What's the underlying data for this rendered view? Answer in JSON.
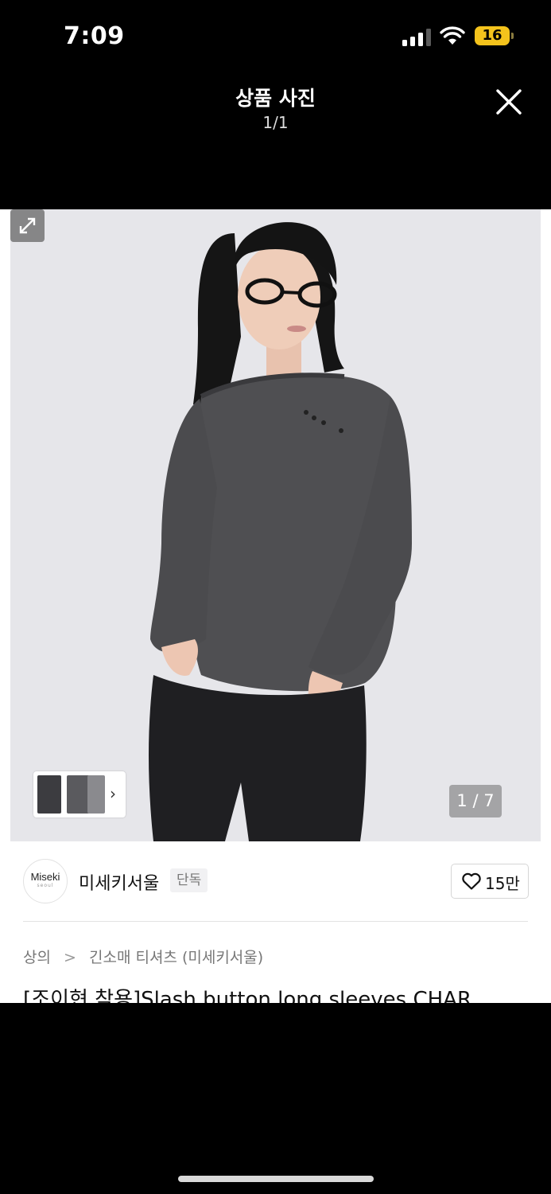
{
  "status_bar": {
    "time": "7:09",
    "battery_level": "16",
    "icons": [
      "cellular-signal-icon",
      "wifi-icon",
      "battery-charging-icon"
    ]
  },
  "header": {
    "title": "상품 사진",
    "counter": "1/1",
    "close_icon": "close-icon"
  },
  "gallery": {
    "page_indicator": "1 / 7",
    "expand_icon": "expand-icon",
    "thumbnail_chevron": "›"
  },
  "brand": {
    "logo_text": "Miseki",
    "logo_subtext": "seoul",
    "name": "미세키서울",
    "tag": "단독",
    "like_count": "15만",
    "like_icon": "heart-outline-icon"
  },
  "breadcrumb": {
    "items": [
      "상의",
      "긴소매 티셔츠 (미세키서울)"
    ],
    "separator": ">"
  },
  "product": {
    "title": "[조이현 착용]Slash button long sleeves CHAR"
  },
  "colors": {
    "background": "#000000",
    "battery": "#f4c31c",
    "garment": "#4f4f52",
    "pants": "#1f1f22"
  }
}
